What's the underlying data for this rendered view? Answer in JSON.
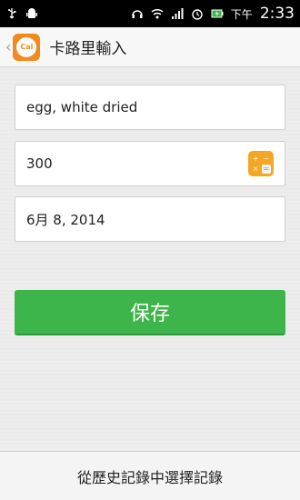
{
  "status_bar": {
    "icons_left": [
      "usb-icon",
      "android-debug-icon"
    ],
    "icons_right": [
      "headphones-icon",
      "wifi-icon",
      "signal-icon",
      "alarm-icon",
      "battery-charging-icon"
    ],
    "time_label": "下午",
    "time": "2:33"
  },
  "action_bar": {
    "back_glyph": "‹",
    "logo_text": "Cal",
    "title": "卡路里輸入"
  },
  "form": {
    "food_name": "egg, white dried",
    "calories": "300",
    "date": "6月 8, 2014",
    "calc_icon": "calculator-icon"
  },
  "save_label": "保存",
  "bottom": {
    "history_label": "從歷史記錄中選擇記錄"
  },
  "colors": {
    "accent_green": "#3db54a",
    "logo_orange": "#f28a1e",
    "calc_orange": "#f5a623"
  }
}
